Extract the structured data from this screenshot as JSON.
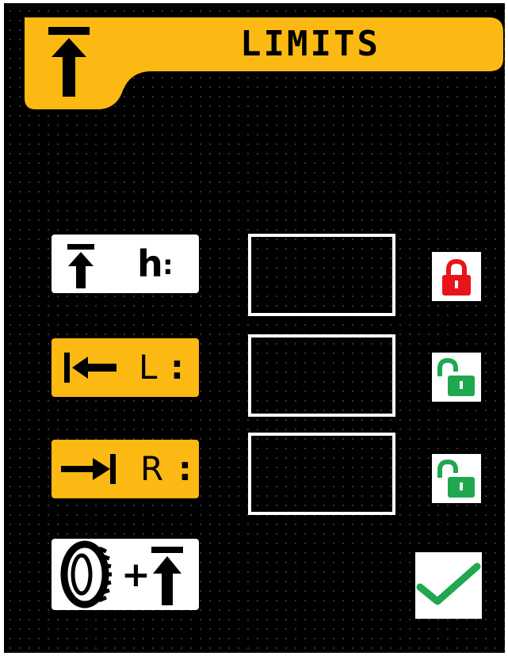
{
  "header": {
    "title": "LIMITS",
    "icon": "height-limit-icon",
    "accent": "#FDB913"
  },
  "rows": [
    {
      "label": "h",
      "separator": ":",
      "icon": "height-limit-icon",
      "value": "",
      "locked": true,
      "lock_icon": "padlock-closed-icon",
      "tile_color": "#FFFFFF",
      "lock_color": "#E8141B"
    },
    {
      "label": "L",
      "separator": ":",
      "icon": "left-limit-arrow-icon",
      "value": "",
      "locked": false,
      "lock_icon": "padlock-open-icon",
      "tile_color": "#FDB913",
      "lock_color": "#1FA84F"
    },
    {
      "label": "R",
      "separator": ":",
      "icon": "right-limit-arrow-icon",
      "value": "",
      "locked": false,
      "lock_icon": "padlock-open-icon",
      "tile_color": "#FDB913",
      "lock_color": "#1FA84F"
    }
  ],
  "tyre_height": {
    "operator": "+",
    "icons": [
      "tyre-icon",
      "height-limit-icon"
    ]
  },
  "confirm": {
    "icon": "checkmark-icon",
    "color": "#1FA84F"
  }
}
